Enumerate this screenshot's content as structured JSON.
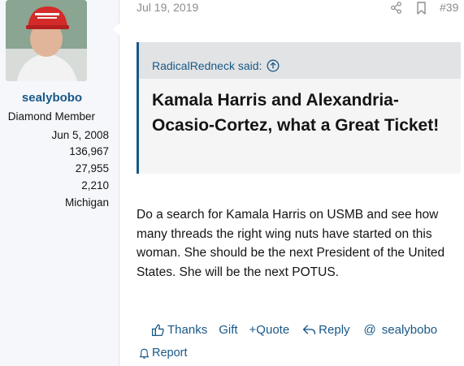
{
  "user": {
    "avatar_icon": "user-avatar-photo",
    "name": "sealybobo",
    "title": "Diamond Member",
    "stats": [
      "Jun 5, 2008",
      "136,967",
      "27,955",
      "2,210",
      "Michigan"
    ]
  },
  "post": {
    "date": "Jul 19, 2019",
    "number": "#39",
    "quote": {
      "author": "RadicalRedneck said:",
      "text": "Kamala Harris and Alexandria-Ocasio-Cortez, what a Great Ticket!"
    },
    "message": "Do a search for Kamala Harris on USMB and see how many threads the right wing nuts have started on this woman. She should be the next President of the United States. She will be the next POTUS."
  },
  "actions": {
    "like": "Thanks",
    "gift": "Gift",
    "quote": "+Quote",
    "reply": "Reply",
    "mention": "sealybobo",
    "report": "Report"
  },
  "colors": {
    "link": "#185886",
    "quote_border": "#185886",
    "muted": "#8c8c8c"
  }
}
